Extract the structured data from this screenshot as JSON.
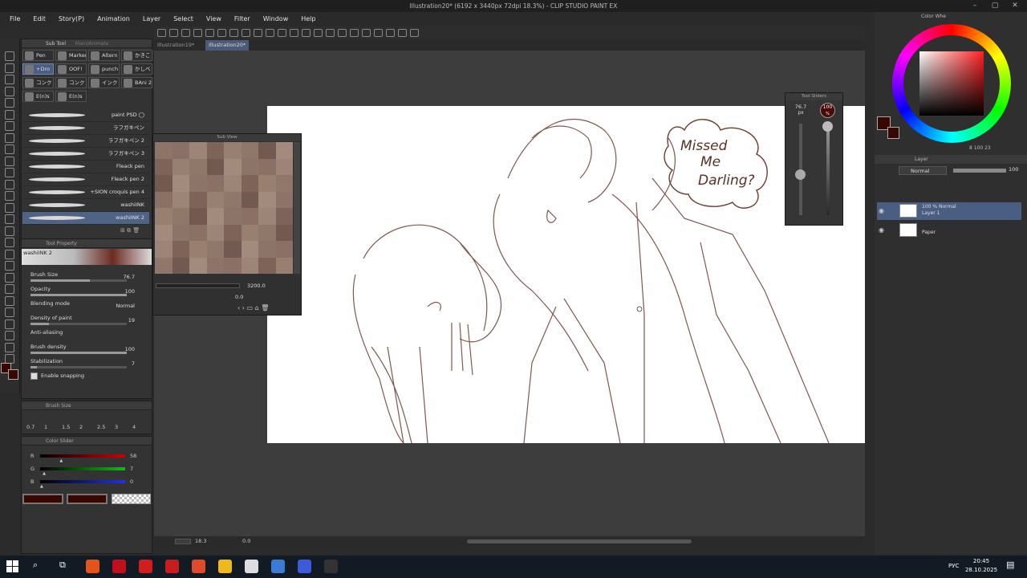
{
  "window": {
    "title": "Illustration20* (6192 x 3440px 72dpi 18.3%) - CLIP STUDIO PAINT EX"
  },
  "menu": [
    "File",
    "Edit",
    "Story(P)",
    "Animation",
    "Layer",
    "Select",
    "View",
    "Filter",
    "Window",
    "Help"
  ],
  "doc_tabs": [
    "Illustration19*",
    "Illustration20*"
  ],
  "subtool_panel": {
    "tabs": [
      "Sub Tool",
      "Main/Animate"
    ],
    "buttons": [
      {
        "label": "Pen",
        "selected": false
      },
      {
        "label": "Marker",
        "selected": false
      },
      {
        "label": "Altern",
        "selected": false
      },
      {
        "label": "かきこ",
        "selected": false
      },
      {
        "label": "+Dro",
        "selected": true
      },
      {
        "label": "OOF!",
        "selected": false
      },
      {
        "label": "punch",
        "selected": false
      },
      {
        "label": "かしべ",
        "selected": false
      },
      {
        "label": "コンク",
        "selected": false
      },
      {
        "label": "コンク",
        "selected": false
      },
      {
        "label": "インク",
        "selected": false
      },
      {
        "label": "BAni 2",
        "selected": false
      },
      {
        "label": "E(n)s",
        "selected": false
      },
      {
        "label": "E(n)s",
        "selected": false
      }
    ],
    "brushes": [
      {
        "name": "paint PSD ◯",
        "selected": false
      },
      {
        "name": "ラフガキペン",
        "selected": false
      },
      {
        "name": "ラフガキペン 2",
        "selected": false
      },
      {
        "name": "ラフガキペン 3",
        "selected": false
      },
      {
        "name": "Fleack pen",
        "selected": false
      },
      {
        "name": "Fleack pen 2",
        "selected": false
      },
      {
        "name": "+SION croquis pen 4",
        "selected": false
      },
      {
        "name": "washiINK",
        "selected": false
      },
      {
        "name": "washiINK 2",
        "selected": true
      }
    ]
  },
  "tool_property": {
    "title": "Tool Property",
    "brush_name": "washiINK 2",
    "rows": [
      {
        "label": "Brush Size",
        "value": "76.7",
        "fill": 0.62
      },
      {
        "label": "Opacity",
        "value": "100",
        "fill": 1.0
      },
      {
        "label": "Blending mode",
        "value": "Normal",
        "fill": 0
      },
      {
        "label": "Density of paint",
        "value": "19",
        "fill": 0.19
      },
      {
        "label": "Anti-aliasing",
        "value": "",
        "fill": 0
      },
      {
        "label": "Brush density",
        "value": "100",
        "fill": 1.0
      },
      {
        "label": "Stabilization",
        "value": "7",
        "fill": 0.07
      }
    ],
    "snapping_label": "Enable snapping"
  },
  "brush_size_panel": {
    "title": "Brush Size",
    "sizes": [
      "0.7",
      "1",
      "1.5",
      "2",
      "2.5",
      "3",
      "4"
    ]
  },
  "color_slider": {
    "title": "Color Slider",
    "channels": [
      {
        "name": "R",
        "value": "58",
        "color": "#d40000",
        "fraction": 0.23
      },
      {
        "name": "G",
        "value": "7",
        "color": "#18b818",
        "fraction": 0.03
      },
      {
        "name": "B",
        "value": "0",
        "color": "#2233dd",
        "fraction": 0.0
      }
    ],
    "main_color": "#3a0700"
  },
  "sub_view": {
    "title": "Sub View",
    "zoom": "3200.0",
    "rotation": "0.0"
  },
  "tool_sliders": {
    "title": "Tool Sliders",
    "size_value": "76.7",
    "size_unit": "px",
    "opacity_value": "100",
    "opacity_unit": "%",
    "size_fraction": 0.45,
    "opacity_fraction": 1.0
  },
  "canvas": {
    "annotation_lines": [
      "Missed",
      "Me",
      "Darling?"
    ]
  },
  "status": {
    "zoom": "18.3",
    "angle": "0.0"
  },
  "color_wheel": {
    "tab": "Color Whe",
    "values": "8  100  23",
    "hue_color": "#c42a2a"
  },
  "layer_panel": {
    "title": "Layer",
    "blend_mode": "Normal",
    "opacity": "100",
    "layers": [
      {
        "line1": "100 % Normal",
        "line2": "Layer 1",
        "selected": true
      },
      {
        "line1": "",
        "line2": "Paper",
        "selected": false
      }
    ]
  },
  "taskbar": {
    "lang": "РУС",
    "time": "20:45",
    "date": "28.10.2025"
  }
}
